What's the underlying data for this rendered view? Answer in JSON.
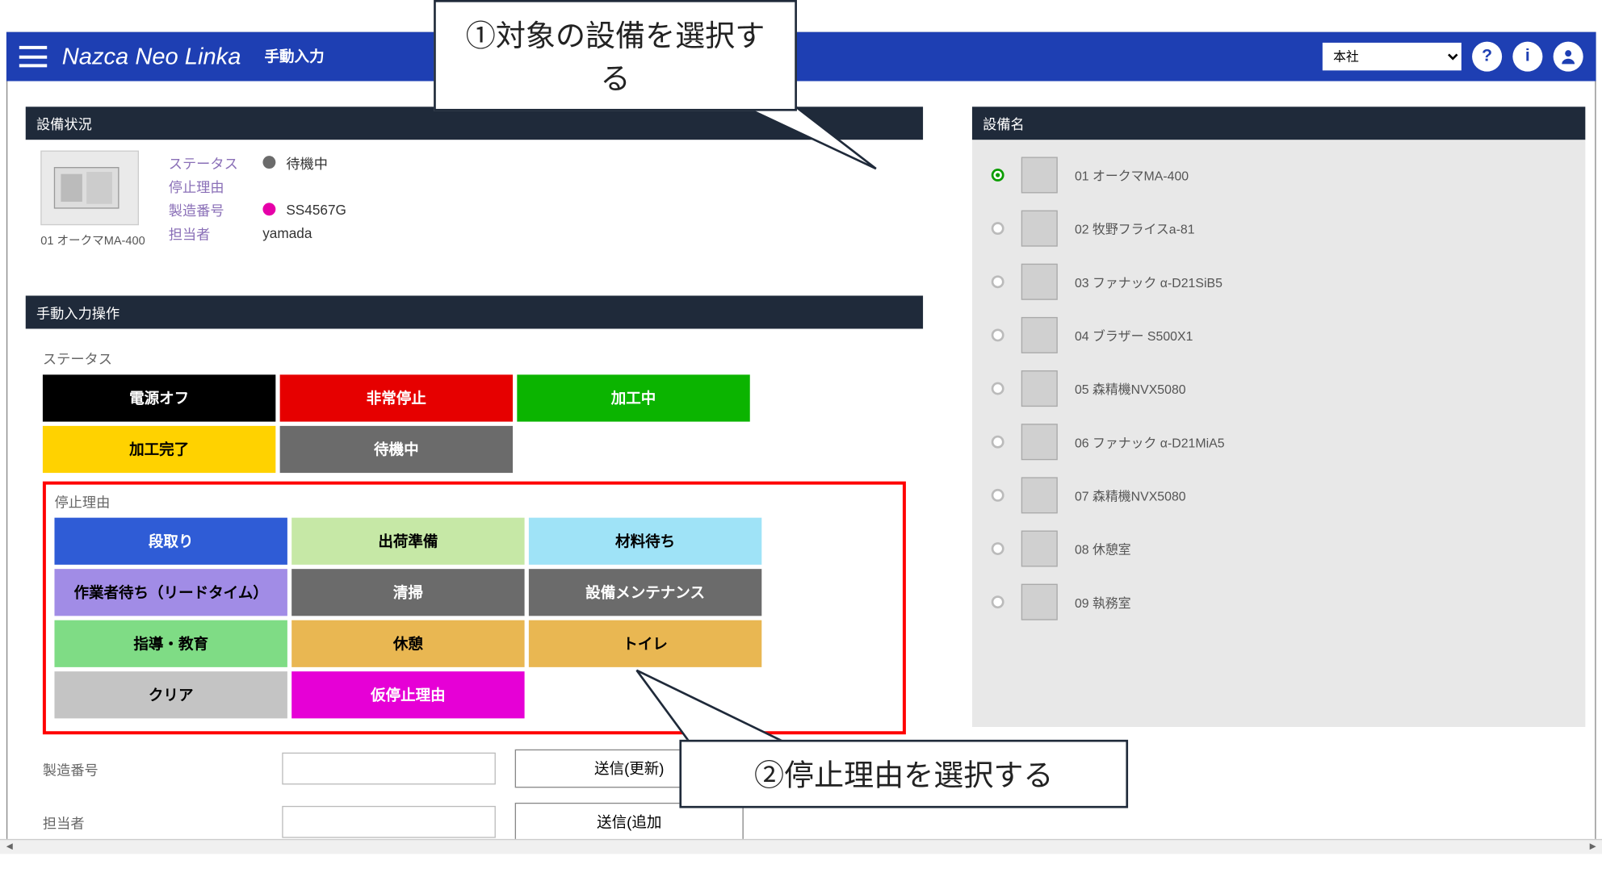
{
  "header": {
    "brand": "Nazca Neo Linka",
    "page_title": "手動入力",
    "location_selected": "本社"
  },
  "callouts": {
    "step1": "①対象の設備を選択する",
    "step2": "②停止理由を選択する"
  },
  "equipment_status": {
    "panel_title": "設備状況",
    "machine_name": "01 オークマMA-400",
    "labels": {
      "status": "ステータス",
      "stop_reason": "停止理由",
      "serial": "製造番号",
      "person": "担当者"
    },
    "values": {
      "status": "待機中",
      "stop_reason": "",
      "serial": "SS4567G",
      "person": "yamada"
    },
    "dot_colors": {
      "status": "#6b6b6b",
      "serial": "#e600a8"
    }
  },
  "manual": {
    "panel_title": "手動入力操作",
    "status_label": "ステータス",
    "reason_label": "停止理由",
    "status_buttons": [
      {
        "label": "電源オフ",
        "cls": "btn-black"
      },
      {
        "label": "非常停止",
        "cls": "btn-red"
      },
      {
        "label": "加工中",
        "cls": "btn-green"
      },
      {
        "label": "加工完了",
        "cls": "btn-yellow"
      },
      {
        "label": "待機中",
        "cls": "btn-gray"
      }
    ],
    "reason_buttons": [
      {
        "label": "段取り",
        "cls": "btn-blue"
      },
      {
        "label": "出荷準備",
        "cls": "btn-ltgreen"
      },
      {
        "label": "材料待ち",
        "cls": "btn-cyan"
      },
      {
        "label": "作業者待ち（リードタイム）",
        "cls": "btn-violet"
      },
      {
        "label": "清掃",
        "cls": "btn-gray"
      },
      {
        "label": "設備メンテナンス",
        "cls": "btn-gray"
      },
      {
        "label": "指導・教育",
        "cls": "btn-green2"
      },
      {
        "label": "休憩",
        "cls": "btn-orange"
      },
      {
        "label": "トイレ",
        "cls": "btn-orange"
      },
      {
        "label": "クリア",
        "cls": "btn-ltgray"
      },
      {
        "label": "仮停止理由",
        "cls": "btn-magenta"
      }
    ],
    "form": {
      "serial_label": "製造番号",
      "person_label": "担当者",
      "send_update": "送信(更新)",
      "send_add": "送信(追加"
    }
  },
  "equipment_list": {
    "panel_title": "設備名",
    "items": [
      {
        "label": "01 オークマMA-400",
        "selected": true
      },
      {
        "label": "02 牧野フライスa-81",
        "selected": false
      },
      {
        "label": "03 ファナック α-D21SiB5",
        "selected": false
      },
      {
        "label": "04 ブラザー S500X1",
        "selected": false
      },
      {
        "label": "05 森精機NVX5080",
        "selected": false
      },
      {
        "label": "06 ファナック α-D21MiA5",
        "selected": false
      },
      {
        "label": "07 森精機NVX5080",
        "selected": false
      },
      {
        "label": "08 休憩室",
        "selected": false
      },
      {
        "label": "09 執務室",
        "selected": false
      }
    ]
  }
}
